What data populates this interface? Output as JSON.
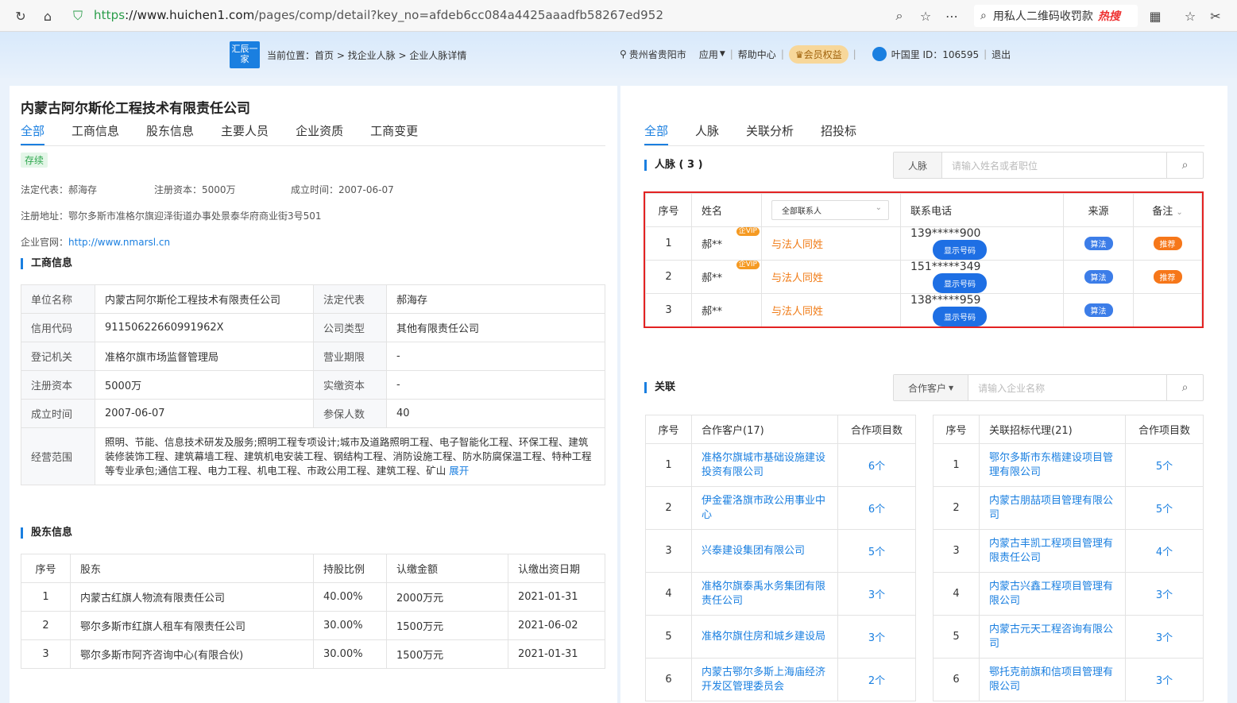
{
  "browser": {
    "url_scheme": "https",
    "url_host": "://www.huichen1.com",
    "url_path": "/pages/comp/detail?key_no=afdeb6cc084a4425aaadfb58267ed952",
    "search_text": "用私人二维码收罚款",
    "search_hot": "热搜"
  },
  "header": {
    "logo": "汇辰一家",
    "breadcrumb": "当前位置：首页 > 找企业人脉 > 企业人脉详情",
    "location": "贵州省贵阳市",
    "apps": "应用",
    "help": "帮助中心",
    "member": "会员权益",
    "user": "叶国里 ID：106595",
    "logout": "退出"
  },
  "company": {
    "name": "内蒙古阿尔斯伦工程技术有限责任公司",
    "tabs": [
      "全部",
      "工商信息",
      "股东信息",
      "主要人员",
      "企业资质",
      "工商变更"
    ],
    "status": "存续",
    "legal": "法定代表：郝海存",
    "capital": "注册资本：5000万",
    "founded": "成立时间：2007-06-07",
    "address": "注册地址：鄂尔多斯市准格尔旗迎泽街道办事处景泰华府商业街3号501",
    "website_label": "企业官网：",
    "website": "http://www.nmarsl.cn"
  },
  "biz": {
    "title": "工商信息",
    "rows": [
      [
        "单位名称",
        "内蒙古阿尔斯伦工程技术有限责任公司",
        "法定代表",
        "郝海存"
      ],
      [
        "信用代码",
        "91150622660991962X",
        "公司类型",
        "其他有限责任公司"
      ],
      [
        "登记机关",
        "准格尔旗市场监督管理局",
        "营业期限",
        "-"
      ],
      [
        "注册资本",
        "5000万",
        "实缴资本",
        "-"
      ],
      [
        "成立时间",
        "2007-06-07",
        "参保人数",
        "40"
      ]
    ],
    "scope_label": "经营范围",
    "scope_text": "照明、节能、信息技术研发及服务;照明工程专项设计;城市及道路照明工程、电子智能化工程、环保工程、建筑装修装饰工程、建筑幕墙工程、建筑机电安装工程、钢结构工程、消防设施工程、防水防腐保温工程、特种工程等专业承包;通信工程、电力工程、机电工程、市政公用工程、建筑工程、矿山",
    "expand": "展开"
  },
  "shareholders": {
    "title": "股东信息",
    "headers": [
      "序号",
      "股东",
      "持股比例",
      "认缴金额",
      "认缴出资日期"
    ],
    "rows": [
      [
        "1",
        "内蒙古红旗人物流有限责任公司",
        "40.00%",
        "2000万元",
        "2021-01-31"
      ],
      [
        "2",
        "鄂尔多斯市红旗人租车有限责任公司",
        "30.00%",
        "1500万元",
        "2021-06-02"
      ],
      [
        "3",
        "鄂尔多斯市阿齐咨询中心(有限合伙)",
        "30.00%",
        "1500万元",
        "2021-01-31"
      ]
    ]
  },
  "right": {
    "tabs": [
      "全部",
      "人脉",
      "关联分析",
      "招投标"
    ],
    "contacts_title": "人脉 ( 3 )",
    "contacts_search_prefix": "人脉",
    "contacts_search_placeholder": "请输入姓名或者职位",
    "contacts_headers": [
      "序号",
      "姓名",
      "全部联系人",
      "联系电话",
      "来源",
      "备注"
    ],
    "contacts": [
      {
        "no": "1",
        "name": "郝**",
        "vip": "企VIP",
        "relation": "与法人同姓",
        "phone": "139*****900",
        "source": "算法",
        "note": "推荐"
      },
      {
        "no": "2",
        "name": "郝**",
        "vip": "企VIP",
        "relation": "与法人同姓",
        "phone": "151*****349",
        "source": "算法",
        "note": "推荐"
      },
      {
        "no": "3",
        "name": "郝**",
        "vip": "",
        "relation": "与法人同姓",
        "phone": "138*****959",
        "source": "算法",
        "note": ""
      }
    ],
    "show_phone": "显示号码",
    "related_title": "关联",
    "related_search_prefix": "合作客户",
    "related_search_placeholder": "请输入企业名称",
    "clients_headers": [
      "序号",
      "合作客户(17)",
      "合作项目数"
    ],
    "clients": [
      [
        "1",
        "准格尔旗城市基础设施建设投资有限公司",
        "6个"
      ],
      [
        "2",
        "伊金霍洛旗市政公用事业中心",
        "6个"
      ],
      [
        "3",
        "兴泰建设集团有限公司",
        "5个"
      ],
      [
        "4",
        "准格尔旗泰禹水务集团有限责任公司",
        "3个"
      ],
      [
        "5",
        "准格尔旗住房和城乡建设局",
        "3个"
      ],
      [
        "6",
        "内蒙古鄂尔多斯上海庙经济开发区管理委员会",
        "2个"
      ]
    ],
    "agents_headers": [
      "序号",
      "关联招标代理(21)",
      "合作项目数"
    ],
    "agents": [
      [
        "1",
        "鄂尔多斯市东楷建设项目管理有限公司",
        "5个"
      ],
      [
        "2",
        "内蒙古朋喆项目管理有限公司",
        "5个"
      ],
      [
        "3",
        "内蒙古丰凯工程项目管理有限责任公司",
        "4个"
      ],
      [
        "4",
        "内蒙古兴鑫工程项目管理有限公司",
        "3个"
      ],
      [
        "5",
        "内蒙古元天工程咨询有限公司",
        "3个"
      ],
      [
        "6",
        "鄂托克前旗和信项目管理有限公司",
        "3个"
      ]
    ]
  }
}
